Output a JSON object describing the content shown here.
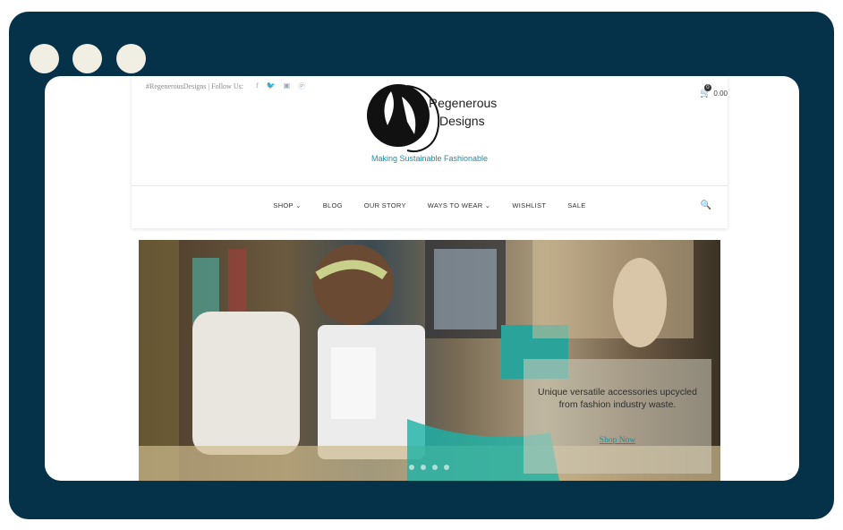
{
  "window": {
    "dots": 3
  },
  "header": {
    "topbar_text": "#RegenerousDesigns | Follow Us:",
    "social_icons": [
      "facebook-icon",
      "twitter-icon",
      "instagram-icon",
      "pinterest-icon"
    ],
    "logo_line1": "Regenerous",
    "logo_line2": "Designs",
    "tagline": "Making Sustainable Fashionable",
    "cart_count": "0",
    "cart_total": "0.00"
  },
  "nav": {
    "items": [
      {
        "label": "SHOP ⌄"
      },
      {
        "label": "BLOG"
      },
      {
        "label": "OUR STORY"
      },
      {
        "label": "WAYS TO WEAR ⌄"
      },
      {
        "label": "WISHLIST"
      },
      {
        "label": "SALE"
      }
    ]
  },
  "hero": {
    "caption": "Unique versatile accessories upcycled from fashion industry waste.",
    "link": "Shop Now",
    "slides": 4
  },
  "colors": {
    "frame": "#063249",
    "accent": "#1b8ea8",
    "cart": "#7fc4b4"
  }
}
